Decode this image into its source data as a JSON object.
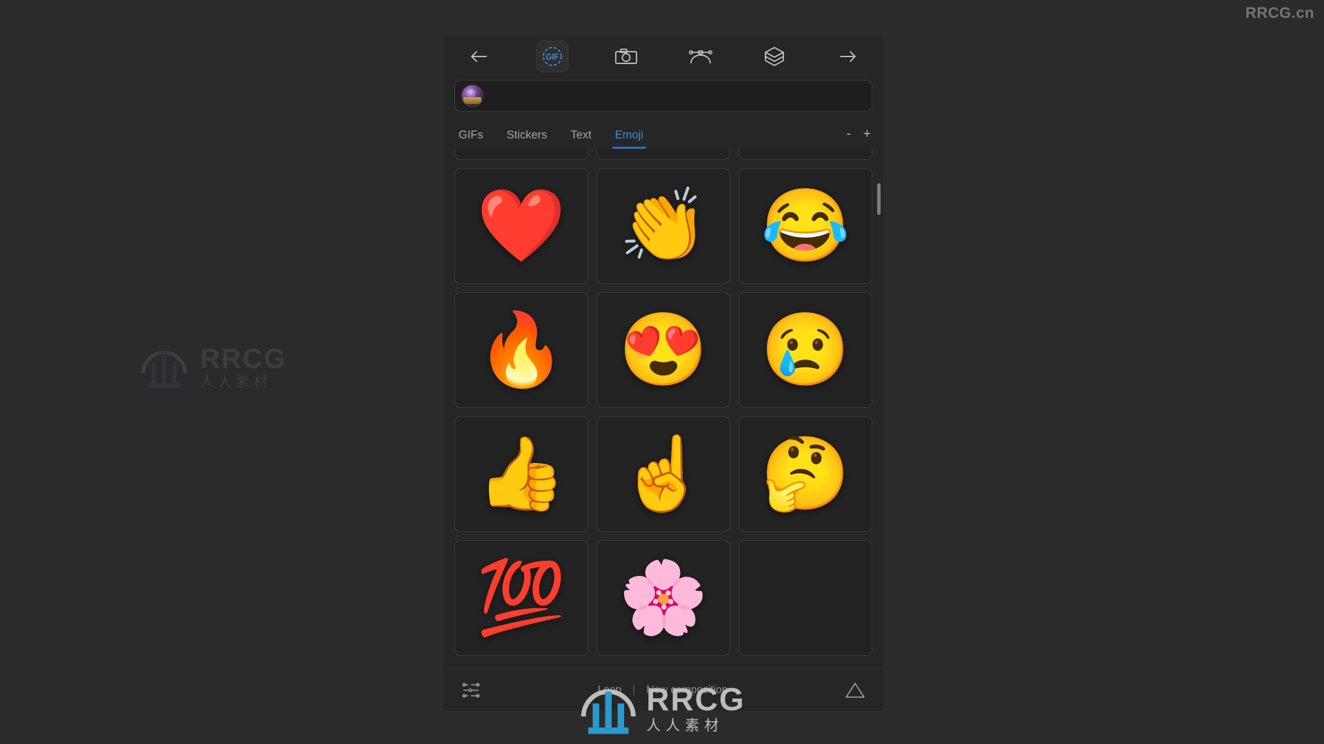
{
  "watermarks": {
    "top_right": "RRCG.cn",
    "left_brand": "RRCG",
    "left_brand_cn": "人人素材",
    "center_brand": "RRCG",
    "center_brand_cn": "人人素材"
  },
  "toolbar": {
    "back_label": "back-arrow",
    "items": [
      {
        "name": "back-arrow-icon",
        "label": "Back",
        "active": false
      },
      {
        "name": "gif-icon",
        "label": "GIF",
        "active": true
      },
      {
        "name": "camera-icon",
        "label": "Camera",
        "active": false
      },
      {
        "name": "bezier-curve-icon",
        "label": "Curve",
        "active": false
      },
      {
        "name": "layers-cube-icon",
        "label": "Layers",
        "active": false
      },
      {
        "name": "forward-arrow-icon",
        "label": "Forward",
        "active": false
      }
    ],
    "gif_glyph": "GIF"
  },
  "search": {
    "value": "",
    "placeholder": "",
    "thumbnail_label": "project-thumbnail"
  },
  "tabs": {
    "items": [
      {
        "label": "GIFs",
        "active": false
      },
      {
        "label": "Stickers",
        "active": false
      },
      {
        "label": "Text",
        "active": false
      },
      {
        "label": "Emoji",
        "active": true
      }
    ],
    "active_color": "#3c8ce0",
    "zoom_out_label": "-",
    "zoom_in_label": "+"
  },
  "grid": {
    "columns": 3,
    "cells": [
      {
        "glyph": "",
        "name": "emoji-cell-empty-1",
        "label": ""
      },
      {
        "glyph": "",
        "name": "emoji-cell-empty-2",
        "label": ""
      },
      {
        "glyph": "",
        "name": "emoji-cell-empty-3",
        "label": ""
      },
      {
        "glyph": "❤️",
        "name": "emoji-cell-red-heart",
        "label": "red heart"
      },
      {
        "glyph": "👏",
        "name": "emoji-cell-clapping-hands",
        "label": "clapping hands"
      },
      {
        "glyph": "😂",
        "name": "emoji-cell-face-tears-of-joy",
        "label": "face with tears of joy"
      },
      {
        "glyph": "🔥",
        "name": "emoji-cell-fire",
        "label": "fire"
      },
      {
        "glyph": "😍",
        "name": "emoji-cell-smiling-face-hearts",
        "label": "smiling face with heart-eyes"
      },
      {
        "glyph": "😢",
        "name": "emoji-cell-crying-face",
        "label": "crying face"
      },
      {
        "glyph": "👍",
        "name": "emoji-cell-thumbs-up",
        "label": "thumbs up"
      },
      {
        "glyph": "☝️",
        "name": "emoji-cell-index-pointing-up",
        "label": "index pointing up"
      },
      {
        "glyph": "🤔",
        "name": "emoji-cell-thinking-face",
        "label": "thinking face"
      },
      {
        "glyph": "💯",
        "name": "emoji-cell-hundred-points",
        "label": "hundred points"
      },
      {
        "glyph": "🌸",
        "name": "emoji-cell-cherry-blossom",
        "label": "cherry blossom"
      },
      {
        "glyph": "",
        "name": "emoji-cell-empty-4",
        "label": ""
      }
    ]
  },
  "bottom": {
    "loop_label": "Loop",
    "separator": "|",
    "new_composition_label": "New composition",
    "settings_icon": "sliders-icon",
    "export_icon": "triangle-icon"
  }
}
